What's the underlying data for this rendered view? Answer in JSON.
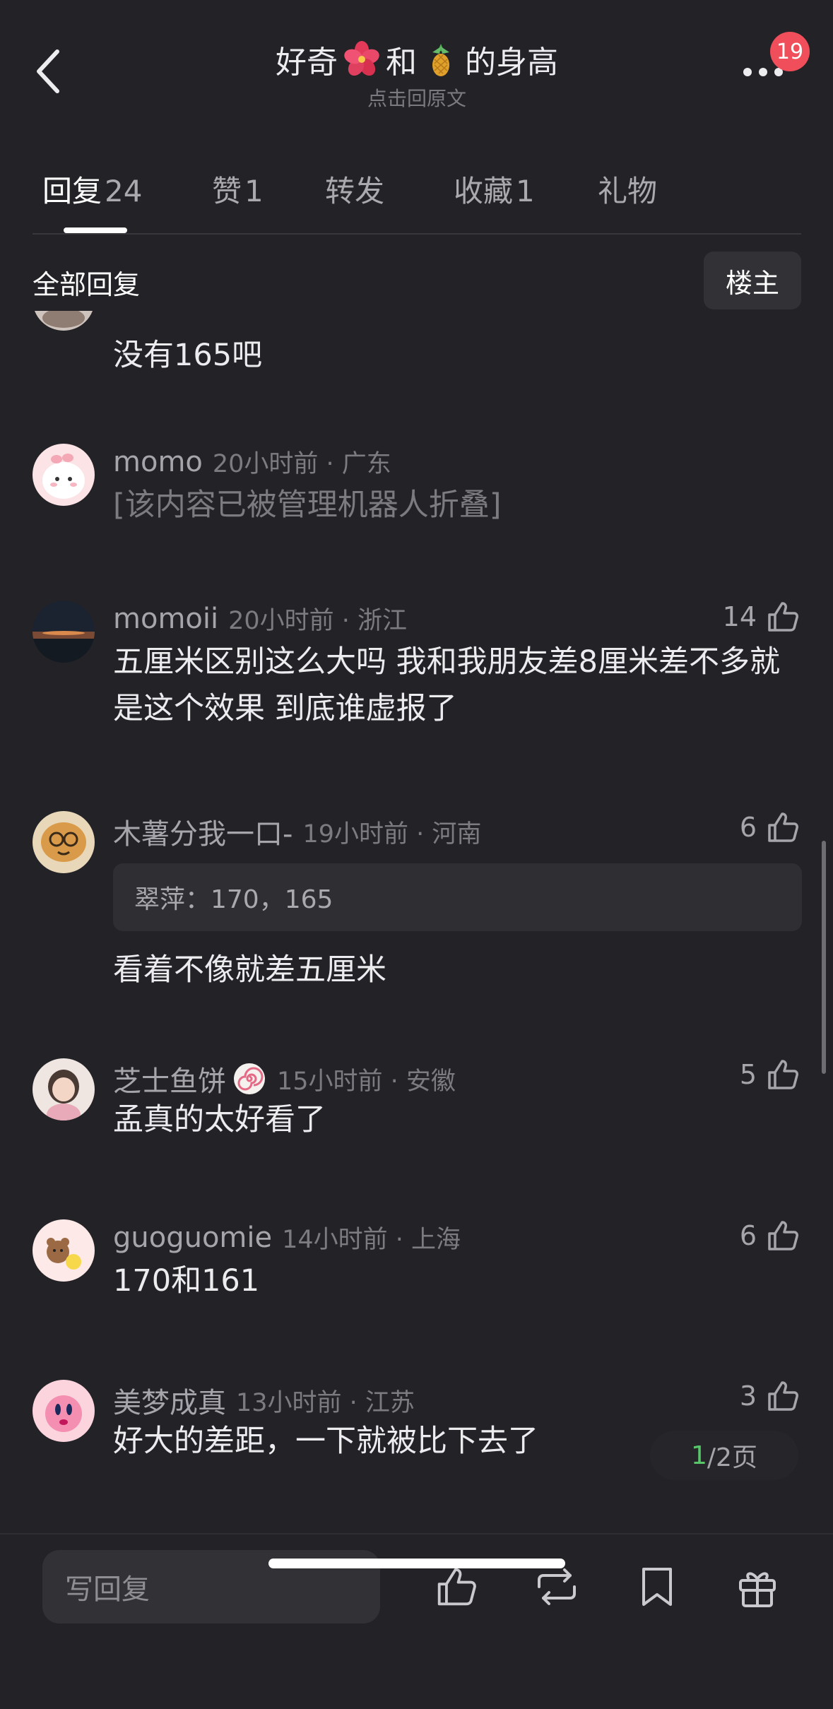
{
  "header": {
    "title_prefix": "好奇",
    "title_mid": "和",
    "title_suffix": "的身高",
    "subtitle": "点击回原文",
    "notification_count": "19"
  },
  "tabs": [
    {
      "label": "回复",
      "count": "24"
    },
    {
      "label": "赞",
      "count": "1"
    },
    {
      "label": "转发",
      "count": ""
    },
    {
      "label": "收藏",
      "count": "1"
    },
    {
      "label": "礼物",
      "count": ""
    }
  ],
  "section": {
    "title": "全部回复",
    "owner_filter": "楼主"
  },
  "comments": [
    {
      "user": "",
      "meta": "",
      "likes": "",
      "text": "没有165吧"
    },
    {
      "user": "momo",
      "meta": "20小时前 · 广东",
      "likes": "",
      "text": "[该内容已被管理机器人折叠]"
    },
    {
      "user": "momoii",
      "meta": "20小时前 · 浙江",
      "likes": "14",
      "text": "五厘米区别这么大吗 我和我朋友差8厘米差不多就是这个效果 到底谁虚报了"
    },
    {
      "user": "木薯分我一口-",
      "meta": "19小时前 · 河南",
      "likes": "6",
      "quote": "翠萍：170，165",
      "text": "看着不像就差五厘米"
    },
    {
      "user": "芝士鱼饼",
      "meta": "15小时前 · 安徽",
      "likes": "5",
      "text": "孟真的太好看了"
    },
    {
      "user": "guoguomie",
      "meta": "14小时前 · 上海",
      "likes": "6",
      "text": "170和161"
    },
    {
      "user": "美梦成真",
      "meta": "13小时前 · 江苏",
      "likes": "3",
      "text": "好大的差距，一下就被比下去了"
    }
  ],
  "pager": {
    "current": "1",
    "total_text": "/2页"
  },
  "bottom": {
    "reply_placeholder": "写回复"
  },
  "colors": {
    "background": "#232327",
    "badge": "#f04e5a",
    "pager_current": "#58c76a"
  },
  "icons": [
    "back-chevron-icon",
    "hibiscus-emoji",
    "pineapple-emoji",
    "more-icon",
    "thumb-up-icon",
    "repost-icon",
    "bookmark-icon",
    "gift-icon",
    "fishcake-emoji"
  ]
}
